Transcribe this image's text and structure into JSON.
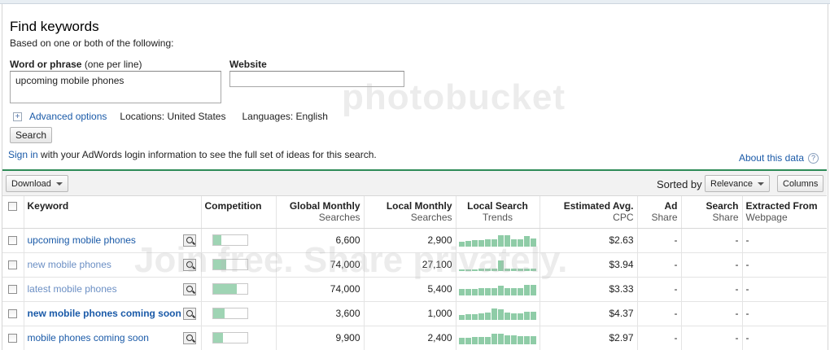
{
  "form": {
    "title": "Find keywords",
    "subtitle": "Based on one or both of the following:",
    "word_label": "Word or phrase",
    "word_hint": "(one per line)",
    "word_value": "upcoming mobile phones",
    "website_label": "Website",
    "website_value": "",
    "advanced_label": "Advanced options",
    "locations": "Locations: United States",
    "languages": "Languages: English",
    "search_button": "Search",
    "signin_link": "Sign in",
    "signin_text": "with your AdWords login information to see the full set of ideas for this search.",
    "about_link": "About this data"
  },
  "toolbar": {
    "download_label": "Download",
    "sorted_label": "Sorted by",
    "relevance_label": "Relevance",
    "columns_label": "Columns"
  },
  "table": {
    "headers": {
      "keyword": "Keyword",
      "competition": "Competition",
      "global_1": "Global Monthly",
      "global_2": "Searches",
      "local_1": "Local Monthly",
      "local_2": "Searches",
      "trends_1": "Local Search",
      "trends_2": "Trends",
      "cpc_1": "Estimated Avg.",
      "cpc_2": "CPC",
      "ad_1": "Ad",
      "ad_2": "Share",
      "search_1": "Search",
      "search_2": "Share",
      "extract_1": "Extracted From",
      "extract_2": "Webpage"
    },
    "rows": [
      {
        "keyword": "upcoming mobile phones",
        "competition": 0.25,
        "global": "6,600",
        "local": "2,900",
        "cpc": "$2.63",
        "ad_share": "-",
        "search_share": "-",
        "extracted": "-",
        "trend": [
          6,
          7,
          8,
          8,
          9,
          9,
          14,
          14,
          9,
          9,
          13,
          10
        ]
      },
      {
        "keyword": "new mobile phones",
        "competition": 0.4,
        "global": "74,000",
        "local": "27,100",
        "cpc": "$3.94",
        "ad_share": "-",
        "search_share": "-",
        "extracted": "-",
        "trend": [
          2,
          2,
          2,
          3,
          3,
          3,
          13,
          3,
          3,
          3,
          3,
          3
        ]
      },
      {
        "keyword": "latest mobile phones",
        "competition": 0.7,
        "global": "74,000",
        "local": "5,400",
        "cpc": "$3.33",
        "ad_share": "-",
        "search_share": "-",
        "extracted": "-",
        "trend": [
          8,
          8,
          8,
          9,
          9,
          9,
          12,
          9,
          9,
          9,
          13,
          13
        ]
      },
      {
        "keyword": "new mobile phones coming soon",
        "competition": 0.35,
        "global": "3,600",
        "local": "1,000",
        "cpc": "$4.37",
        "ad_share": "-",
        "search_share": "-",
        "extracted": "-",
        "trend": [
          6,
          7,
          7,
          8,
          9,
          14,
          13,
          9,
          8,
          8,
          10,
          10
        ]
      },
      {
        "keyword": "mobile phones coming soon",
        "competition": 0.3,
        "global": "9,900",
        "local": "2,400",
        "cpc": "$2.97",
        "ad_share": "-",
        "search_share": "-",
        "extracted": "-",
        "trend": [
          8,
          8,
          9,
          9,
          9,
          13,
          13,
          11,
          11,
          10,
          10,
          10
        ]
      }
    ]
  },
  "watermark": {
    "line1": "photobucket",
    "line2": "Join free. Share privately."
  },
  "colors": {
    "link": "#1a5aa8",
    "accent_rule": "#2e8b57",
    "bar_fill": "#9fd4b4"
  }
}
